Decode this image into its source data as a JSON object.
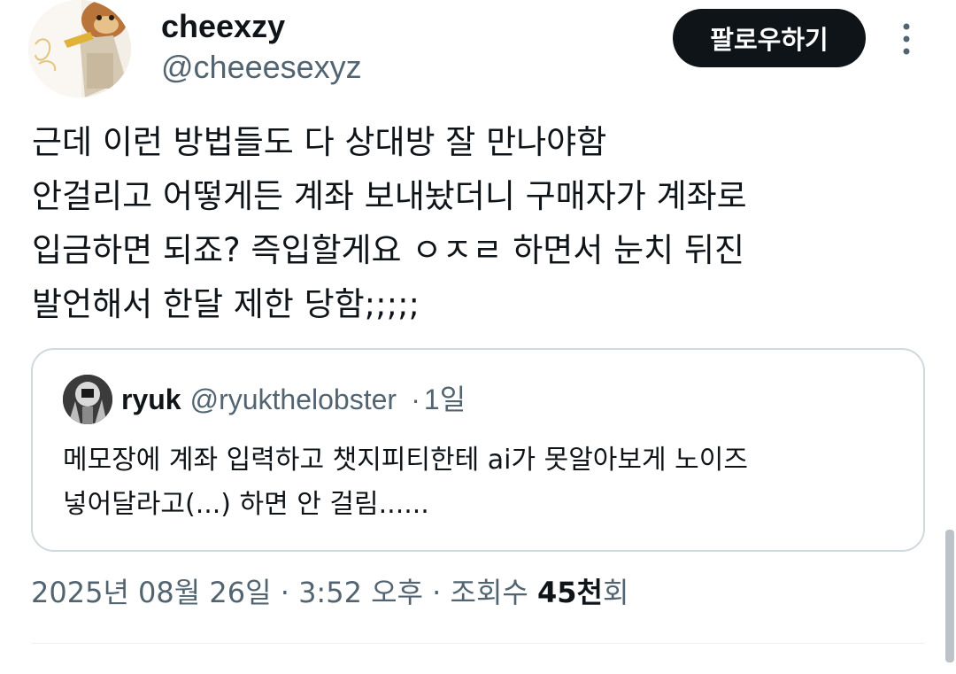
{
  "author": {
    "display_name": "cheexzy",
    "handle": "@cheeesexyz"
  },
  "header": {
    "follow_label": "팔로우하기",
    "more_icon": "more-vertical-icon"
  },
  "tweet": {
    "lines": [
      "근데 이런 방법들도 다 상대방 잘 만나야함",
      "안걸리고 어떻게든 계좌 보내놨더니 구매자가 계좌로",
      "입금하면 되죠? 즉입할게요 ㅇㅈㄹ 하면서 눈치 뒤진",
      "발언해서 한달 제한 당함;;;;;"
    ]
  },
  "quote": {
    "name": "ryuk",
    "handle": "@ryukthelobster",
    "separator": "·",
    "time": "1일",
    "lines": [
      "메모장에 계좌 입력하고 챗지피티한테 ai가 못알아보게 노이즈",
      "넣어달라고(...) 하면 안 걸림......"
    ]
  },
  "meta": {
    "date": "2025년 08월 26일",
    "separator": "·",
    "time": "3:52 오후",
    "views_label": "조회수",
    "views_count": "45천",
    "views_suffix": "회"
  },
  "colors": {
    "text_primary": "#0f1419",
    "text_secondary": "#536471",
    "border": "#cfd9de",
    "follow_bg": "#0f1419"
  }
}
